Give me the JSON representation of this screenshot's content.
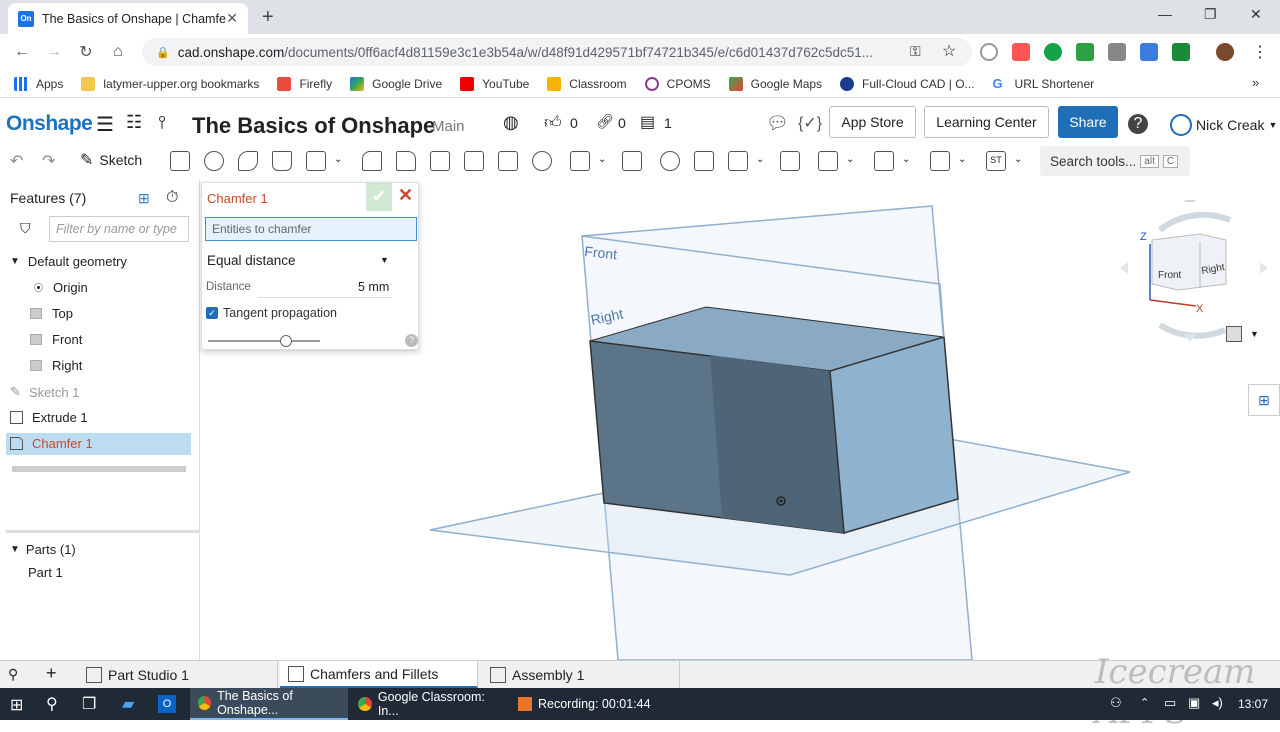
{
  "browser": {
    "tab_title": "The Basics of Onshape | Chamfer",
    "url_host": "cad.onshape.com",
    "url_path": "/documents/0ff6acf4d81159e3c1e3b54a/w/d48f91d429571bf74721b345/e/c6d01437d762c5dc51..."
  },
  "bookmarks": [
    "Apps",
    "latymer-upper.org bookmarks",
    "Firefly",
    "Google Drive",
    "YouTube",
    "Classroom",
    "CPOMS",
    "Google Maps",
    "Full-Cloud CAD | O...",
    "URL Shortener"
  ],
  "header": {
    "logo": "Onshape",
    "doc_title": "The Basics of Onshape",
    "branch": "Main",
    "likes": "0",
    "links": "0",
    "versions": "1",
    "app_store": "App Store",
    "learning_center": "Learning Center",
    "share": "Share",
    "user": "Nick Creak"
  },
  "toolbar": {
    "sketch": "Sketch",
    "search": "Search tools...",
    "key_alt": "alt",
    "key_c": "C"
  },
  "features": {
    "title": "Features (7)",
    "filter_placeholder": "Filter by name or type",
    "default_geometry": "Default geometry",
    "origin": "Origin",
    "top": "Top",
    "front": "Front",
    "right": "Right",
    "sketch1": "Sketch 1",
    "extrude1": "Extrude 1",
    "chamfer1": "Chamfer 1",
    "parts": "Parts (1)",
    "part1": "Part 1"
  },
  "dialog": {
    "title": "Chamfer 1",
    "entities_placeholder": "Entities to chamfer",
    "method": "Equal distance",
    "distance_label": "Distance",
    "distance_value": "5 mm",
    "tangent": "Tangent propagation"
  },
  "viewport": {
    "plane_front": "Front",
    "plane_right": "Right",
    "cube_front": "Front",
    "cube_right": "Right",
    "axis_z": "Z",
    "axis_x": "X"
  },
  "bottom_tabs": [
    "Part Studio 1",
    "Chamfers and Fillets",
    "Assembly 1"
  ],
  "taskbar": {
    "app1": "The Basics of Onshape...",
    "app2": "Google Classroom: In...",
    "app3": "Recording:  00:01:44",
    "clock": "13:07"
  },
  "watermark": "Icecream APPS"
}
